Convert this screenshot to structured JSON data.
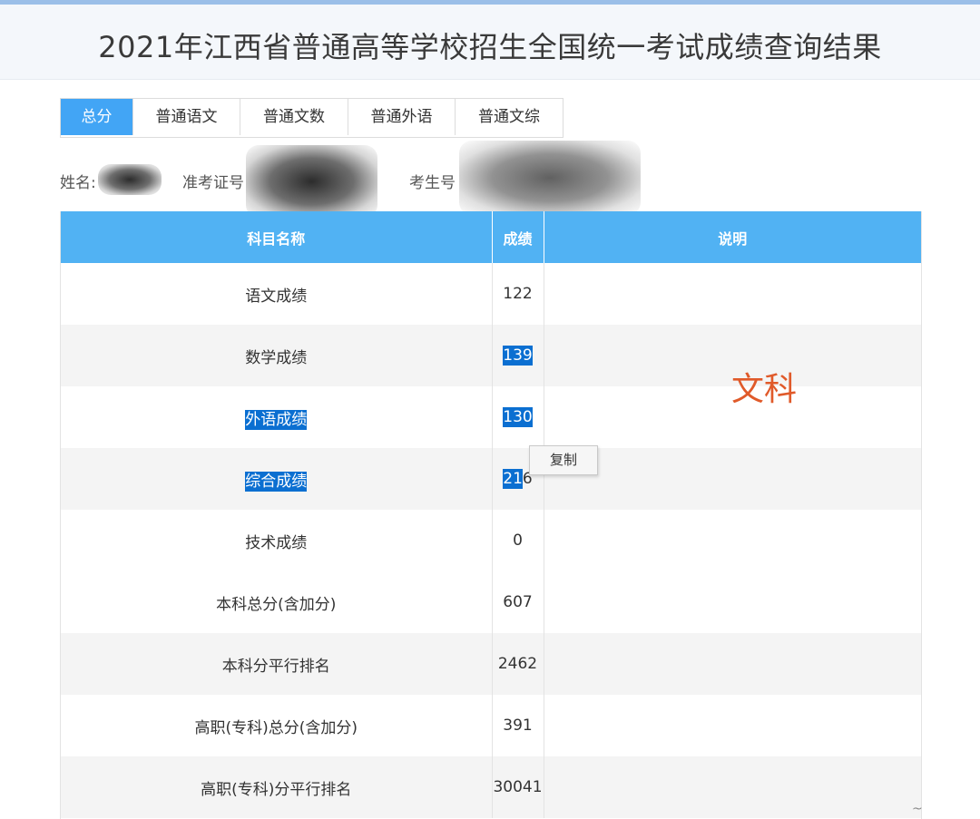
{
  "page_title": "2021年江西省普通高等学校招生全国统一考试成绩查询结果",
  "tabs": [
    {
      "label": "总分",
      "active": true
    },
    {
      "label": "普通语文",
      "active": false
    },
    {
      "label": "普通文数",
      "active": false
    },
    {
      "label": "普通外语",
      "active": false
    },
    {
      "label": "普通文综",
      "active": false
    }
  ],
  "info": {
    "name_label": "姓名:",
    "exam_id_label": "准考证号",
    "student_id_label": "考生号"
  },
  "table": {
    "headers": [
      "科目名称",
      "成绩",
      "说明"
    ],
    "rows": [
      {
        "subject": "语文成绩",
        "score": "122",
        "note": ""
      },
      {
        "subject": "数学成绩",
        "score": "139",
        "note": ""
      },
      {
        "subject": "外语成绩",
        "score": "130",
        "note": ""
      },
      {
        "subject": "综合成绩",
        "score_selected": "21",
        "score_rest": "6",
        "note": ""
      },
      {
        "subject": "技术成绩",
        "score": "0",
        "note": ""
      },
      {
        "subject": "本科总分(含加分)",
        "score": "607",
        "note": ""
      },
      {
        "subject": "本科分平行排名",
        "score": "2462",
        "note": ""
      },
      {
        "subject": "高职(专科)总分(含加分)",
        "score": "391",
        "note": ""
      },
      {
        "subject": "高职(专科)分平行排名",
        "score": "30041",
        "note": ""
      }
    ]
  },
  "annotation": "文科",
  "context_menu": {
    "copy_label": "复制"
  },
  "colors": {
    "accent": "#42a5f5",
    "table_header": "#51b2f3",
    "selection": "#0b6fd1",
    "annotation": "#e05a2a"
  }
}
